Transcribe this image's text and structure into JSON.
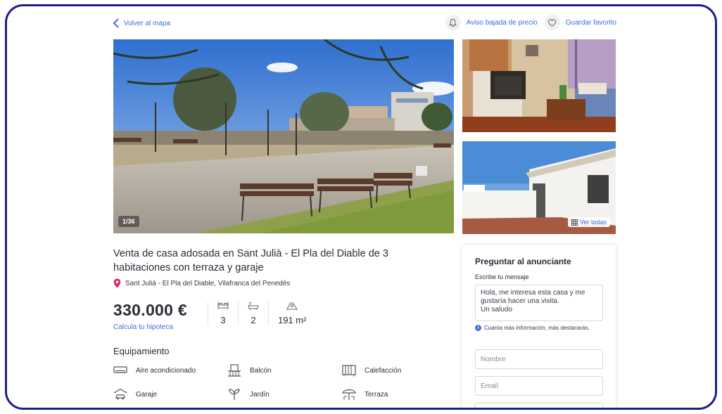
{
  "nav": {
    "back_label": "Volver al mapa",
    "price_alert_label": "Aviso bajada de precio",
    "favorite_label": "Guardar favorito"
  },
  "gallery": {
    "counter": "1/36",
    "see_all_label": "Ver todas"
  },
  "listing": {
    "title": "Venta de casa adosada en Sant Julià - El Pla del Diable de 3 habitaciones con terraza y garaje",
    "location": "Sant Julià - El Pla del Diable, Vilafranca del Penedès",
    "price": "330.000 €",
    "mortgage_link": "Calcula tu hipoteca",
    "bedrooms": "3",
    "bathrooms": "2",
    "area": "191 m²"
  },
  "equipment": {
    "title": "Equipamiento",
    "items": [
      {
        "label": "Aire acondicionado",
        "icon": "air-conditioner-icon"
      },
      {
        "label": "Balcón",
        "icon": "balcony-icon"
      },
      {
        "label": "Calefacción",
        "icon": "radiator-icon"
      },
      {
        "label": "Garaje",
        "icon": "garage-icon"
      },
      {
        "label": "Jardín",
        "icon": "plant-icon"
      },
      {
        "label": "Terraza",
        "icon": "parasol-icon"
      }
    ]
  },
  "contact": {
    "title": "Preguntar al anunciante",
    "message_label": "Escribe tu mensaje",
    "message_value": "Hola, me interesa esta casa y me gustaría hacer una visita.\nUn saludo",
    "hint": "Cuanta más información, más destacarás.",
    "name_placeholder": "Nombre",
    "email_placeholder": "Email"
  },
  "colors": {
    "accent": "#3d6fd6",
    "frame": "#1c1f8a",
    "pin": "#e0245e"
  }
}
